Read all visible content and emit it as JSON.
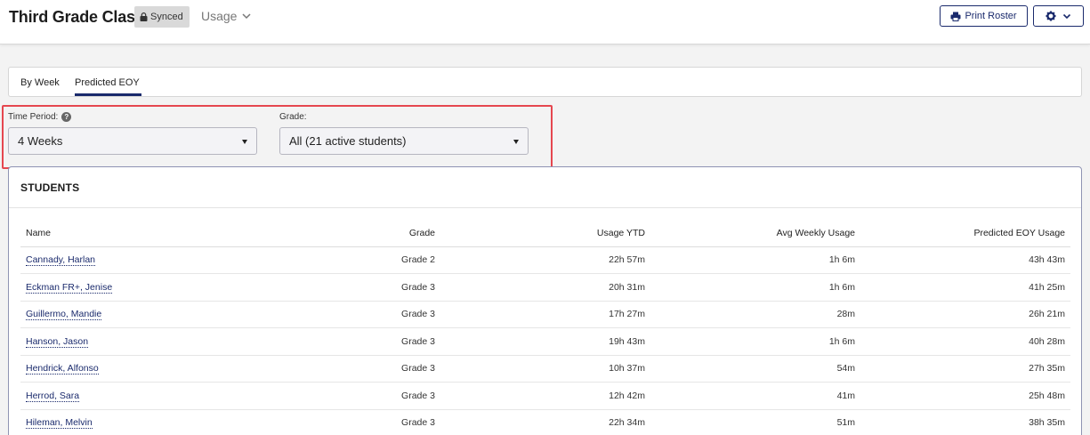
{
  "header": {
    "class_title": "Third Grade Class",
    "synced_label": "Synced",
    "usage_label": "Usage",
    "print_label": "Print Roster"
  },
  "tabs": [
    {
      "label": "By Week",
      "active": false
    },
    {
      "label": "Predicted EOY",
      "active": true
    }
  ],
  "filters": {
    "time_period": {
      "label": "Time Period:",
      "value": "4 Weeks"
    },
    "grade": {
      "label": "Grade:",
      "value": "All (21 active students)"
    }
  },
  "students": {
    "title": "STUDENTS",
    "columns": [
      "Name",
      "Grade",
      "Usage YTD",
      "Avg Weekly Usage",
      "Predicted EOY Usage"
    ],
    "rows": [
      {
        "name": "Cannady, Harlan",
        "grade": "Grade 2",
        "ytd": "22h 57m",
        "avg": "1h 6m",
        "eoy": "43h 43m"
      },
      {
        "name": "Eckman FR+, Jenise",
        "grade": "Grade 3",
        "ytd": "20h 31m",
        "avg": "1h 6m",
        "eoy": "41h 25m"
      },
      {
        "name": "Guillermo, Mandie",
        "grade": "Grade 3",
        "ytd": "17h 27m",
        "avg": "28m",
        "eoy": "26h 21m"
      },
      {
        "name": "Hanson, Jason",
        "grade": "Grade 3",
        "ytd": "19h 43m",
        "avg": "1h 6m",
        "eoy": "40h 28m"
      },
      {
        "name": "Hendrick, Alfonso",
        "grade": "Grade 3",
        "ytd": "10h 37m",
        "avg": "54m",
        "eoy": "27h 35m"
      },
      {
        "name": "Herrod, Sara",
        "grade": "Grade 3",
        "ytd": "12h 42m",
        "avg": "41m",
        "eoy": "25h 48m"
      },
      {
        "name": "Hileman, Melvin",
        "grade": "Grade 3",
        "ytd": "22h 34m",
        "avg": "51m",
        "eoy": "38h 35m"
      }
    ]
  },
  "colors": {
    "accent": "#1a2a6c",
    "highlight": "#e5474f",
    "badge_bg": "#d9d9d9"
  },
  "icons": {
    "lock": "lock-icon",
    "chevron": "chevron-down-icon",
    "printer": "printer-icon",
    "gear": "gear-icon",
    "help": "help-icon",
    "caret": "caret-down-icon"
  }
}
